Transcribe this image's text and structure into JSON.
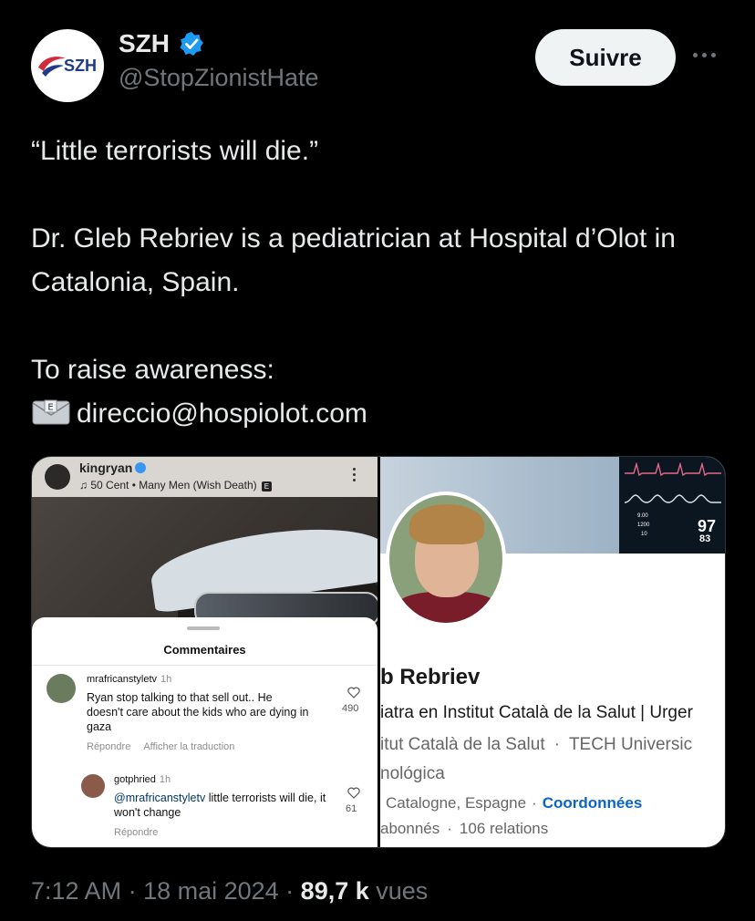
{
  "tweet": {
    "author_name": "SZH",
    "author_handle": "@StopZionistHate",
    "avatar_text": "SZH",
    "follow_label": "Suivre",
    "lines": [
      "“Little terrorists will die.”",
      "Dr. Gleb Rebriev is a pediatrician at Hospital d’Olot in Catalonia, Spain.",
      "To raise awareness:",
      "direccio@hospiolot.com"
    ],
    "envelope_icon": "envelope-icon",
    "meta": {
      "time": "7:12 AM",
      "date": "18 mai 2024",
      "views": "89,7 k",
      "views_label": "vues"
    }
  },
  "media": {
    "instagram": {
      "username": "kingryan",
      "music": "50 Cent • Many Men (Wish Death)",
      "explicit_badge": "E",
      "comments_title": "Commentaires",
      "comments": [
        {
          "user": "mrafricanstyletv",
          "time": "1h",
          "text": "Ryan stop talking to that sell out.. He doesn't care about the kids who are dying in gaza",
          "reply": "Répondre",
          "translate": "Afficher la traduction",
          "likes": "490"
        },
        {
          "user": "gotphried",
          "time": "1h",
          "mention": "@mrafricanstyletv",
          "text": " little terrorists will die, it won't change",
          "reply": "Répondre",
          "likes": "61"
        }
      ]
    },
    "linkedin": {
      "name": "b Rebriev",
      "headline": "iatra en Institut Català de la Salut | Urger",
      "edu_1": "itut Català de la Salut",
      "edu_2": "TECH Universic",
      "edu_3": "nológica",
      "location": "Catalogne, Espagne",
      "contact": "Coordonnées",
      "followers": "abonnés",
      "relations": "106 relations",
      "monitor": {
        "pct": "97",
        "sub": "83",
        "v1": "9.00",
        "v2": "1200",
        "v3": "10"
      }
    }
  },
  "colors": {
    "background": "#000000",
    "text": "#e7e9ea",
    "muted": "#71767b",
    "verified": "#1d9bf0",
    "link": "#0a66c2"
  }
}
